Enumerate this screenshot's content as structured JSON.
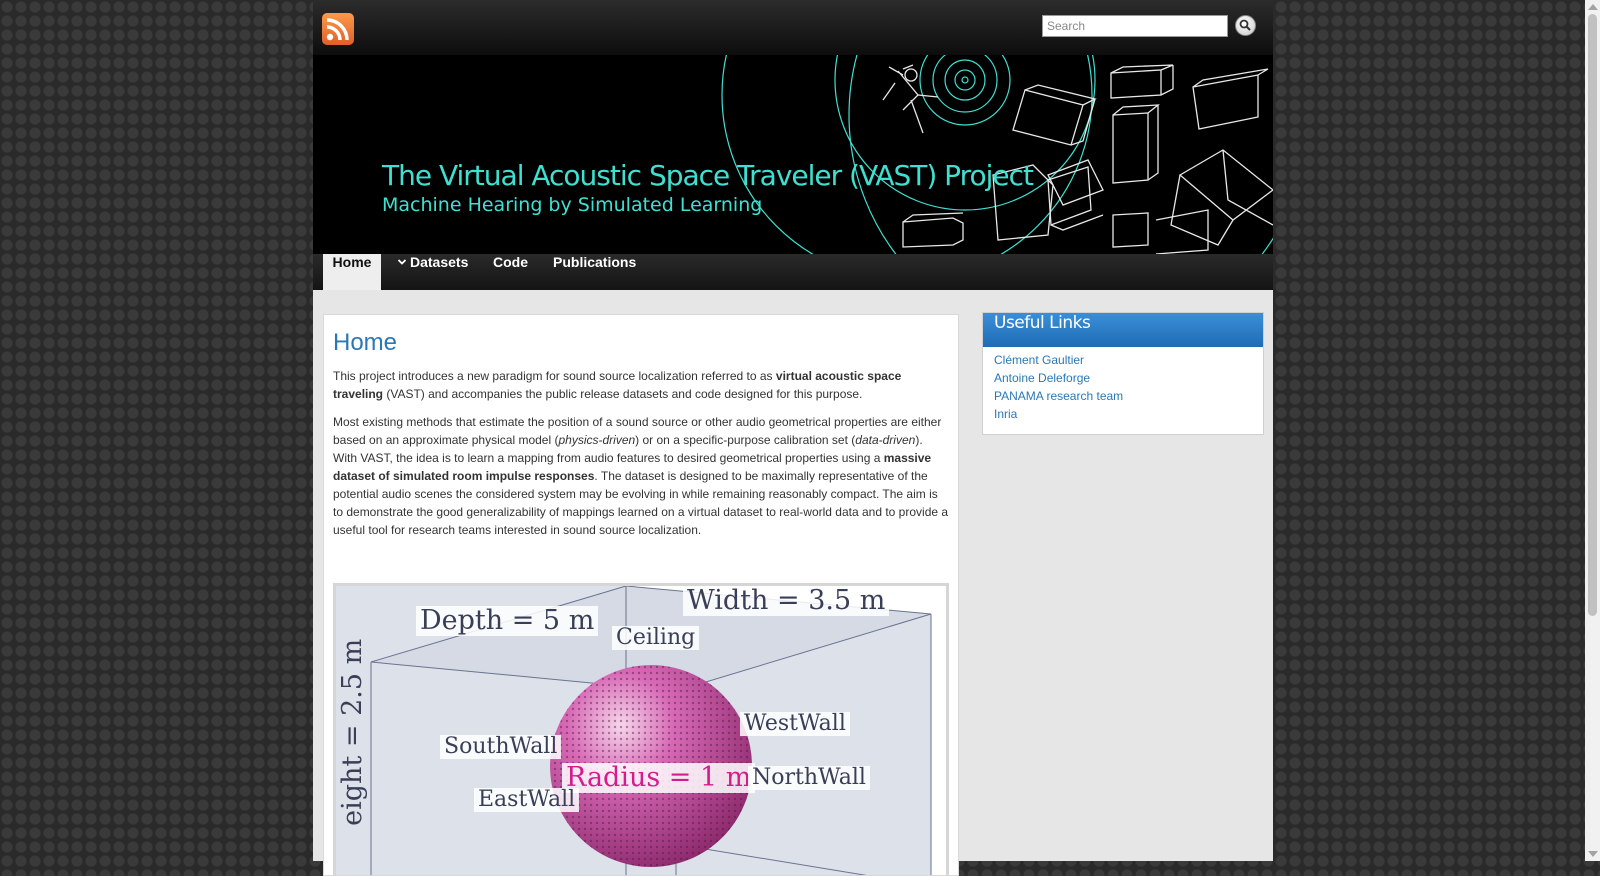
{
  "search": {
    "placeholder": "Search"
  },
  "banner": {
    "title": "The Virtual Acoustic Space Traveler (VAST) Project",
    "subtitle": "Machine Hearing by Simulated Learning"
  },
  "nav": {
    "items": [
      {
        "label": "Home",
        "active": true
      },
      {
        "label": "Datasets",
        "has_dropdown": true
      },
      {
        "label": "Code"
      },
      {
        "label": "Publications"
      }
    ]
  },
  "main": {
    "title": "Home",
    "p1": {
      "a": "This project introduces a new paradigm for sound source localization referred to as ",
      "b": "virtual acoustic space traveling",
      "c": " (VAST) and accompanies the public release datasets and code designed for this purpose."
    },
    "p2": {
      "a": "Most existing methods that estimate the position of a sound source or other audio geometrical properties are either based on an approximate physical model (",
      "b": "physics-driven",
      "c": ") or on a specific-purpose calibration set (",
      "d": "data-driven",
      "e": "). With VAST, the idea is to learn a mapping from audio features to desired geometrical properties using a ",
      "f": "massive dataset of simulated room impulse responses",
      "g": ". The dataset is designed to be maximally representative of the potential audio scenes the considered system may be evolving in while remaining reasonably compact. The aim is to demonstrate the good generalizability of mappings learned on a virtual dataset  to real-world data and to provide a useful tool for research teams interested in sound source localization."
    },
    "figure": {
      "depth": "Depth = 5 m",
      "width": "Width = 3.5 m",
      "height": "eight = 2.5 m",
      "ceiling": "Ceiling",
      "west": "WestWall",
      "south": "SouthWall",
      "radius": "Radius = 1 m",
      "north": "NorthWall",
      "east": "EastWall"
    }
  },
  "sidebar": {
    "title": "Useful Links",
    "links": [
      "Clément Gaultier",
      "Antoine Deleforge",
      "PANAMA research team",
      "Inria"
    ]
  },
  "colors": {
    "accent": "#2a78b5",
    "banner_text": "#3ee0d2",
    "sphere": "#c0409a"
  }
}
